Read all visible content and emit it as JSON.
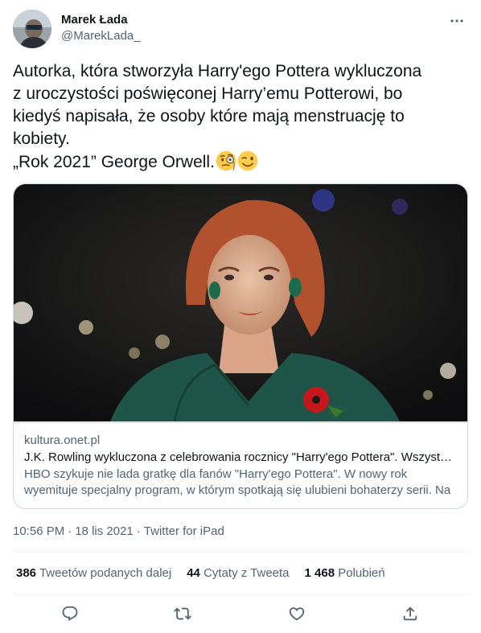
{
  "author": {
    "display_name": "Marek Łada",
    "handle": "@MarekLada_",
    "avatar_icon": "avatar"
  },
  "tweet": {
    "lines": [
      "Autorka, która stworzyła Harry'ego Pottera wykluczona",
      "z uroczystości poświęconej Harry’emu Potterowi, bo",
      "kiedyś napisała, że osoby które mają menstruację to",
      "kobiety.",
      "„Rok 2021” George Orwell."
    ],
    "emojis": [
      "monocle-face-emoji",
      "winking-face-emoji"
    ]
  },
  "card": {
    "domain": "kultura.onet.pl",
    "title": "J.K. Rowling wykluczona z celebrowania rocznicy \"Harry'ego Pottera\". Wszystkie gwiazdy",
    "description_lines": [
      "HBO szykuje nie lada gratkę dla fanów \"Harry'ego Pottera\". W nowy rok",
      "wyemituje specjalny program, w którym spotkają się ulubieni bohaterzy serii. Na"
    ]
  },
  "meta": {
    "time": "10:56 PM",
    "date": "18 lis 2021",
    "source": "Twitter for iPad",
    "separator": "·"
  },
  "stats": [
    {
      "count": "386",
      "label": "Tweetów podanych dalej"
    },
    {
      "count": "44",
      "label": "Cytaty z Tweeta"
    },
    {
      "count": "1 468",
      "label": "Polubień"
    }
  ],
  "actions": [
    "reply-icon",
    "retweet-icon",
    "like-icon",
    "share-icon"
  ],
  "colors": {
    "text": "#0f1419",
    "secondary": "#536471",
    "border": "#cfd9de",
    "divider": "#eff3f4"
  }
}
